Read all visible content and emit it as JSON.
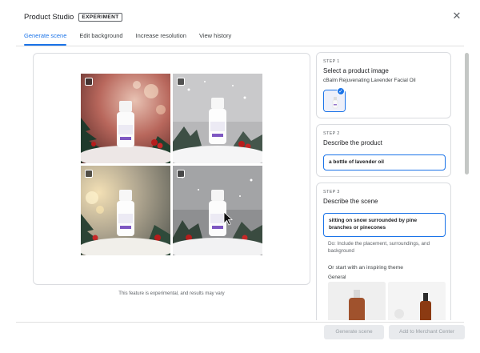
{
  "header": {
    "title": "Product Studio",
    "badge": "EXPERIMENT",
    "close_icon": "close-icon"
  },
  "tabs": [
    {
      "label": "Generate scene",
      "active": true
    },
    {
      "label": "Edit background",
      "active": false
    },
    {
      "label": "Increase resolution",
      "active": false
    },
    {
      "label": "View history",
      "active": false
    }
  ],
  "preview": {
    "note": "This feature is experimental, and results may vary",
    "product_label": "cBalm"
  },
  "steps": {
    "step1": {
      "label": "STEP 1",
      "title": "Select a product image",
      "subtitle": "cBalm Rejuvenating Lavender Facial Oil"
    },
    "step2": {
      "label": "STEP 2",
      "title": "Describe the product",
      "value": "a bottle of lavender oil"
    },
    "step3": {
      "label": "STEP 3",
      "title": "Describe the scene",
      "value": "sitting on snow surrounded by pine branches or pinecones",
      "help": "Do: Include the placement, surroundings, and background",
      "theme_label": "Or start with an inspiring theme",
      "theme_category": "General"
    }
  },
  "footer": {
    "generate_label": "Generate scene",
    "merchant_label": "Add to Merchant Center"
  },
  "colors": {
    "accent": "#1a73e8",
    "disabled_button": "#e8eaed"
  }
}
